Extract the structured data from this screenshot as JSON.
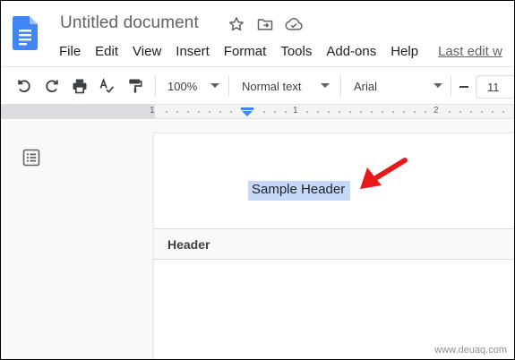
{
  "title_bar": {
    "document_title": "Untitled document",
    "icons": [
      "star-icon",
      "move-to-folder-icon",
      "cloud-saved-icon"
    ]
  },
  "menu": {
    "items": [
      "File",
      "Edit",
      "View",
      "Insert",
      "Format",
      "Tools",
      "Add-ons",
      "Help"
    ],
    "last_edit": "Last edit w"
  },
  "toolbar": {
    "icons": [
      "undo-icon",
      "redo-icon",
      "print-icon",
      "spellcheck-icon",
      "paint-format-icon"
    ],
    "zoom": "100%",
    "style": "Normal text",
    "font": "Arial",
    "font_size": "11",
    "decrease_label": "−"
  },
  "ruler": {
    "numbers": [
      "1",
      "1",
      "2"
    ]
  },
  "document": {
    "header_text": "Sample Header",
    "header_section_label": "Header"
  },
  "watermark": "www.deuaq.com",
  "colors": {
    "docs_blue": "#4285f4",
    "selection": "#c6d8f8",
    "ruler_marker": "#4285f4",
    "annotation_arrow": "#e8191c"
  }
}
